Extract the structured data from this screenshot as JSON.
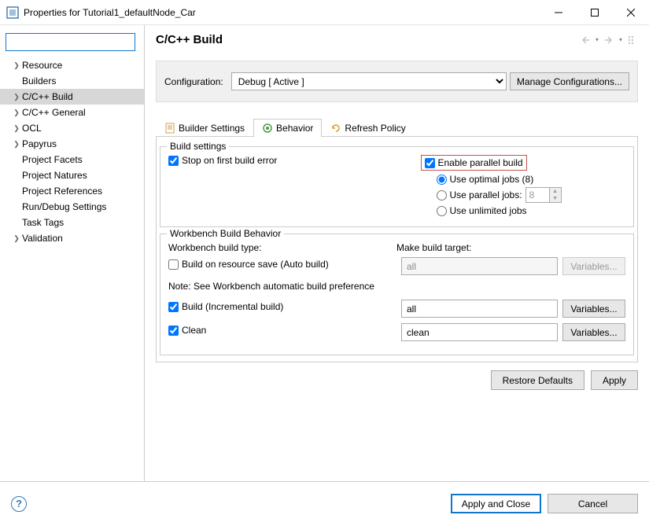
{
  "window": {
    "title": "Properties for Tutorial1_defaultNode_Car"
  },
  "sidebar": {
    "filter_value": "",
    "items": [
      {
        "label": "Resource",
        "expandable": true
      },
      {
        "label": "Builders",
        "expandable": false
      },
      {
        "label": "C/C++ Build",
        "expandable": true,
        "selected": true
      },
      {
        "label": "C/C++ General",
        "expandable": true
      },
      {
        "label": "OCL",
        "expandable": true
      },
      {
        "label": "Papyrus",
        "expandable": true
      },
      {
        "label": "Project Facets",
        "expandable": false
      },
      {
        "label": "Project Natures",
        "expandable": false
      },
      {
        "label": "Project References",
        "expandable": false
      },
      {
        "label": "Run/Debug Settings",
        "expandable": false
      },
      {
        "label": "Task Tags",
        "expandable": false
      },
      {
        "label": "Validation",
        "expandable": true
      }
    ]
  },
  "content": {
    "title": "C/C++ Build",
    "config_label": "Configuration:",
    "config_value": "Debug  [ Active ]",
    "manage_btn": "Manage Configurations...",
    "tabs": [
      {
        "label": "Builder Settings"
      },
      {
        "label": "Behavior",
        "active": true
      },
      {
        "label": "Refresh Policy"
      }
    ],
    "build_settings": {
      "title": "Build settings",
      "stop_on_error": "Stop on first build error",
      "enable_parallel": "Enable parallel build",
      "use_optimal": "Use optimal jobs (8)",
      "use_parallel": "Use parallel jobs:",
      "parallel_value": "8",
      "use_unlimited": "Use unlimited jobs"
    },
    "workbench": {
      "title": "Workbench Build Behavior",
      "type_label": "Workbench build type:",
      "target_label": "Make build target:",
      "build_auto": "Build on resource save (Auto build)",
      "build_auto_target": "all",
      "note": "Note: See Workbench automatic build preference",
      "build_inc": "Build (Incremental build)",
      "build_inc_target": "all",
      "clean": "Clean",
      "clean_target": "clean",
      "variables_btn": "Variables..."
    },
    "restore_btn": "Restore Defaults",
    "apply_btn": "Apply"
  },
  "footer": {
    "apply_close": "Apply and Close",
    "cancel": "Cancel"
  }
}
